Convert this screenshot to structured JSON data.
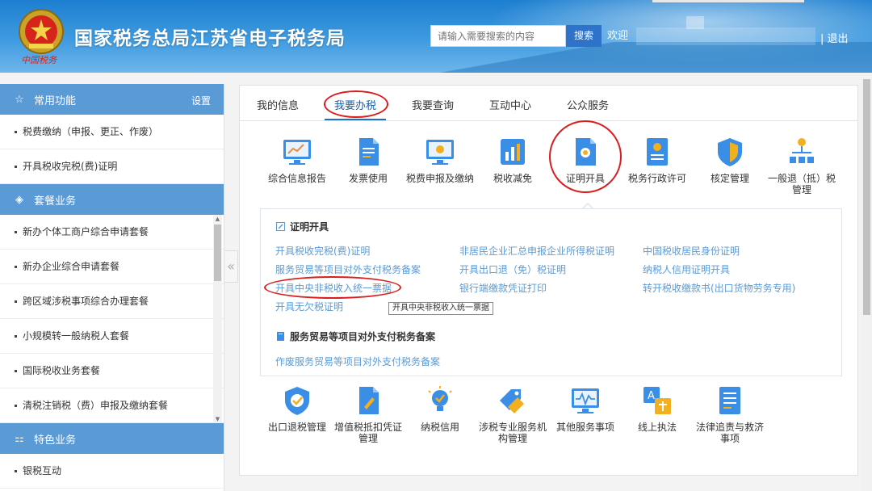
{
  "header": {
    "site_title": "国家税务总局江苏省电子税务局",
    "emblem_caption": "中国税务",
    "search_placeholder": "请输入需要搜索的内容",
    "search_button": "搜索",
    "welcome": "欢迎",
    "logout": "| 退出"
  },
  "sidebar": {
    "sections": [
      {
        "title": "常用功能",
        "icon": "star-icon",
        "setting": "设置",
        "items": [
          "税费缴纳（申报、更正、作废）",
          "开具税收完税(费)证明"
        ]
      },
      {
        "title": "套餐业务",
        "icon": "layers-icon",
        "items": [
          "新办个体工商户综合申请套餐",
          "新办企业综合申请套餐",
          "跨区域涉税事项综合办理套餐",
          "小规模转一般纳税人套餐",
          "国际税收业务套餐",
          "清税注销税（费）申报及缴纳套餐"
        ]
      },
      {
        "title": "特色业务",
        "icon": "grid-icon",
        "items": [
          "银税互动"
        ]
      }
    ],
    "collapse_icon": "double-chevron-left-icon"
  },
  "main": {
    "tabs": [
      "我的信息",
      "我要办税",
      "我要查询",
      "互动中心",
      "公众服务"
    ],
    "active_tab": "我要办税",
    "functions_row1": [
      {
        "label": "综合信息报告",
        "icon": "monitor-chart-icon"
      },
      {
        "label": "发票使用",
        "icon": "document-icon"
      },
      {
        "label": "税费申报及缴纳",
        "icon": "monitor-icon"
      },
      {
        "label": "税收减免",
        "icon": "bar-chart-icon"
      },
      {
        "label": "证明开具",
        "icon": "certificate-icon"
      },
      {
        "label": "税务行政许可",
        "icon": "license-icon"
      },
      {
        "label": "核定管理",
        "icon": "shield-icon"
      },
      {
        "label": "一般退（抵）税管理",
        "icon": "org-chart-icon"
      }
    ],
    "cert_panel": {
      "section1_title": "证明开具",
      "section1_links": [
        "开具税收完税(费)证明",
        "非居民企业汇总申报企业所得税证明",
        "中国税收居民身份证明",
        "服务贸易等项目对外支付税务备案",
        "开具出口退（免）税证明",
        "纳税人信用证明开具",
        "开具中央非税收入统一票据",
        "银行端缴款凭证打印",
        "转开税收缴款书(出口货物劳务专用)",
        "开具无欠税证明"
      ],
      "tooltip": "开具中央非税收入统一票据",
      "section2_title": "服务贸易等项目对外支付税务备案",
      "section2_links": [
        "作废服务贸易等项目对外支付税务备案"
      ]
    },
    "functions_row2": [
      {
        "label": "出口退税管理",
        "icon": "shield-check-icon"
      },
      {
        "label": "增值税抵扣凭证管理",
        "icon": "document-edit-icon"
      },
      {
        "label": "纳税信用",
        "icon": "bulb-check-icon"
      },
      {
        "label": "涉税专业服务机构管理",
        "icon": "tags-icon"
      },
      {
        "label": "其他服务事项",
        "icon": "monitor-wave-icon"
      },
      {
        "label": "线上执法",
        "icon": "translate-icon"
      },
      {
        "label": "法律追责与救济事项",
        "icon": "list-document-icon"
      }
    ]
  },
  "colors": {
    "header_blue": "#1d7fd0",
    "sidebar_header": "#5b9bd5",
    "link_blue": "#5b9bd5",
    "highlight_red": "#d81e1e",
    "tab_active": "#1a5ca8"
  }
}
